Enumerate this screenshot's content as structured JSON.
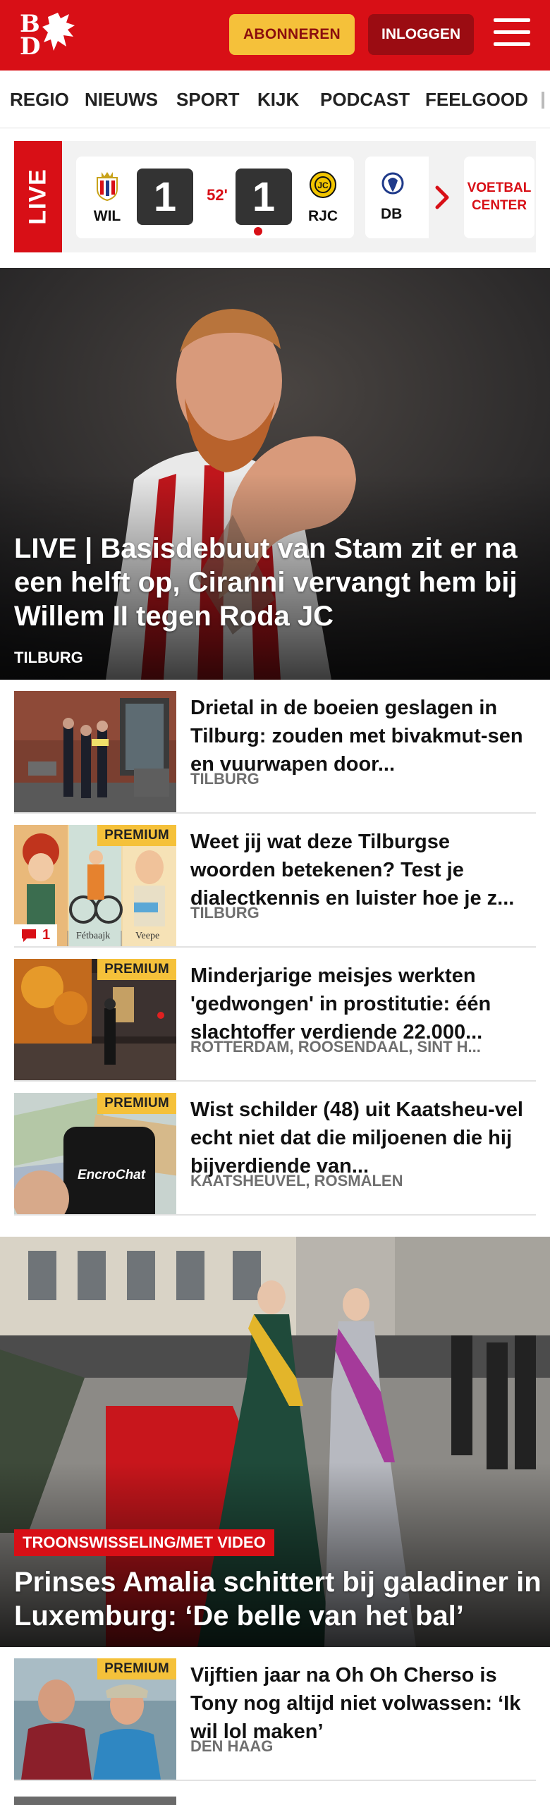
{
  "header": {
    "logo_letters": [
      "B",
      "D"
    ],
    "subscribe_label": "ABONNEREN",
    "login_label": "INLOGGEN",
    "brand_color": "#d80f16"
  },
  "nav": {
    "items": [
      "REGIO",
      "NIEUWS",
      "SPORT",
      "KIJK",
      "PODCAST",
      "FEELGOOD"
    ]
  },
  "live": {
    "label": "LIVE",
    "match": {
      "home": "WIL",
      "away": "RJC",
      "home_score": "1",
      "away_score": "1",
      "minute": "52'"
    },
    "next_match_home": "DB",
    "center_label_1": "VOETBAL",
    "center_label_2": "CENTER"
  },
  "hero": {
    "title": "LIVE | Basisdebuut van Stam zit er na een helft op, Ciranni vervangt hem bij Willem II tegen Roda JC",
    "location": "TILBURG"
  },
  "articles": [
    {
      "title": "Drietal in de boeien geslagen in Tilburg: zouden met bivakmut-sen en vuurwapen door...",
      "location": "TILBURG",
      "premium": false
    },
    {
      "title": "Weet jij wat deze Tilburgse woorden betekenen? Test je dialectkennis en luister hoe je z...",
      "location": "TILBURG",
      "premium": true,
      "premium_label": "PREMIUM",
      "comment_count": "1",
      "thumb_words": [
        "Fétbaajk",
        "Veepe"
      ]
    },
    {
      "title": "Minderjarige meisjes werkten 'gedwongen' in prostitutie: één slachtoffer verdiende 22.000...",
      "location": "ROTTERDAM, ROOSENDAAL, SINT H...",
      "premium": true,
      "premium_label": "PREMIUM"
    },
    {
      "title": "Wist schilder (48) uit Kaatsheu-vel echt niet dat die miljoenen die hij bijverdiende van...",
      "location": "KAATSHEUVEL, ROSMALEN",
      "premium": true,
      "premium_label": "PREMIUM",
      "thumb_word": "EncroChat"
    }
  ],
  "hero2": {
    "tag": "TROONSWISSELING/MET VIDEO",
    "title": "Prinses Amalia schittert bij galadiner in Luxemburg: ‘De belle van het bal’"
  },
  "article_last": {
    "title": "Vijftien jaar na Oh Oh Cherso is Tony nog altijd niet volwassen: ‘Ik wil lol maken’",
    "location": "DEN HAAG",
    "premium_label": "PREMIUM"
  }
}
